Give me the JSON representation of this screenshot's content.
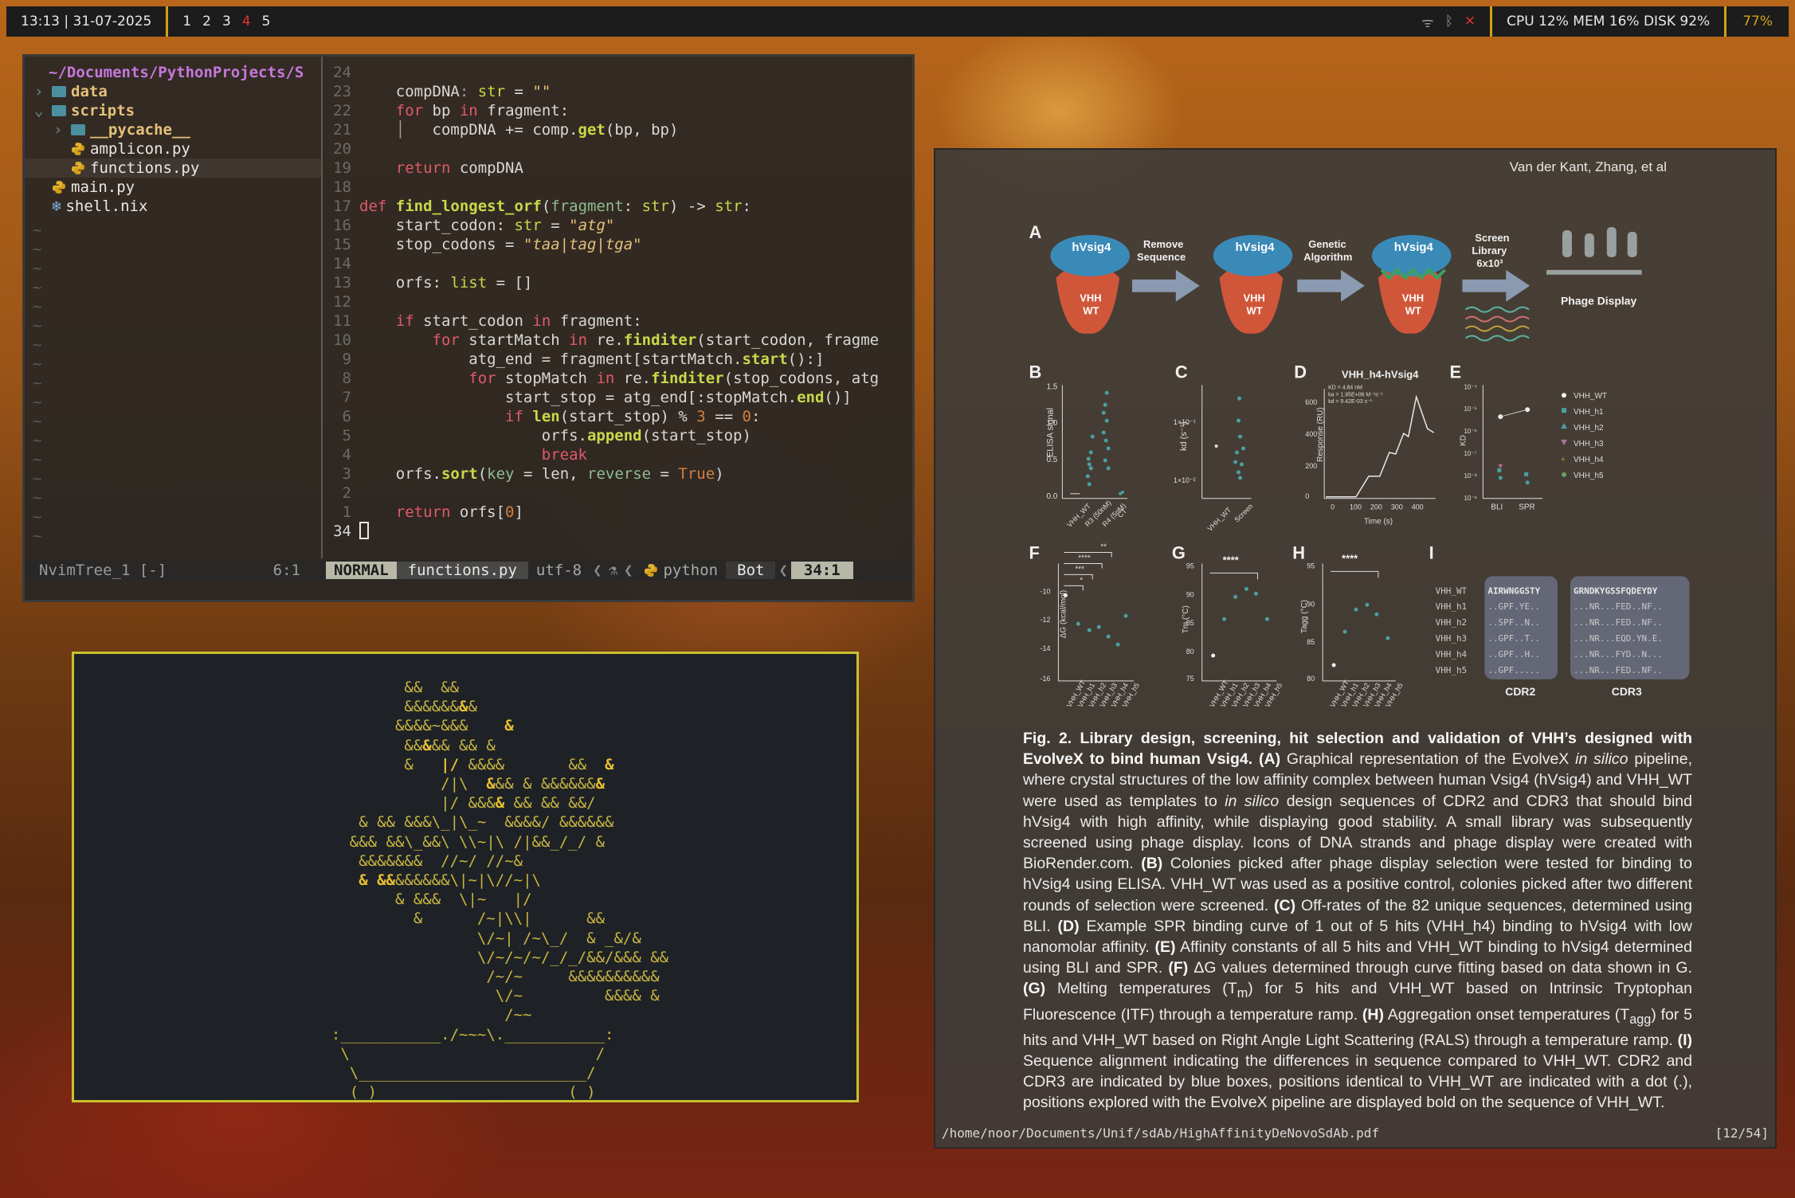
{
  "topbar": {
    "clock": "13:13 | 31-07-2025",
    "workspaces": [
      "1",
      "2",
      "3",
      "4",
      "5"
    ],
    "active_workspace": "4",
    "status_icons": [
      "wifi-icon",
      "bluetooth-icon",
      "close-icon"
    ],
    "resources": "CPU 12% MEM 16% DISK 92%",
    "battery": "77%"
  },
  "nvim": {
    "tree": {
      "root": "~/Documents/PythonProjects/S",
      "items": [
        {
          "chev": "›",
          "name": "data",
          "kind": "dir"
        },
        {
          "chev": "⌄",
          "name": "scripts",
          "kind": "dir"
        },
        {
          "chev": "›",
          "name": "__pycache__",
          "kind": "dir",
          "indent": 1
        },
        {
          "chev": "",
          "name": "amplicon.py",
          "kind": "py",
          "indent": 1
        },
        {
          "chev": "",
          "name": "functions.py",
          "kind": "py",
          "indent": 1,
          "selected": true
        },
        {
          "chev": "",
          "name": "main.py",
          "kind": "py"
        },
        {
          "chev": "",
          "name": "shell.nix",
          "kind": "nix"
        }
      ]
    },
    "status": {
      "tree_name": "NvimTree_1 [-]",
      "tree_pos": "6:1",
      "mode": "NORMAL",
      "file": "functions.py",
      "encoding": "utf-8",
      "filetype": "python",
      "scroll": "Bot",
      "position": "34:1"
    },
    "line_numbers": [
      "24",
      "23",
      "22",
      "21",
      "20",
      "19",
      "18",
      "17",
      "16",
      "15",
      "14",
      "13",
      "12",
      "11",
      "10",
      "9",
      "8",
      "7",
      "6",
      "5",
      "4",
      "3",
      "2",
      "1",
      "34"
    ]
  },
  "pdf": {
    "authors": "Van der Kant, Zhang, et al",
    "path": "/home/noor/Documents/Unif/sdAb/HighAffinityDeNovoSdAb.pdf",
    "page": "[12/54]",
    "figure": {
      "panelA": {
        "label": "A",
        "proteins": [
          "hVsig4",
          "hVsig4",
          "hVsig4"
        ],
        "binder": [
          "VHH",
          "WT"
        ],
        "steps": [
          "Remove",
          "Sequence",
          "Genetic",
          "Algorithm",
          "Screen",
          "Library",
          "6x10³"
        ],
        "phage": "Phage Display"
      },
      "panelB": {
        "label": "B",
        "ylabel": "ELISA signal",
        "yticks": [
          "1.5",
          "1.0",
          "0.5",
          "0.0"
        ],
        "xticks": [
          "VHH_WT",
          "R3 (50nM)",
          "R4 (5nM)",
          "CT"
        ]
      },
      "panelC": {
        "label": "C",
        "ylabel": "kd (s⁻¹)",
        "yticks": [
          "1×10⁻¹",
          "1×10⁻²"
        ],
        "xticks": [
          "VHH_WT",
          "Screen"
        ]
      },
      "panelD": {
        "label": "D",
        "title": "VHH_h4-hVsig4",
        "ylabel": "Response (RU)",
        "xlabel": "Time (s)",
        "yticks": [
          "600",
          "400",
          "200",
          "0"
        ],
        "xticks": [
          "0",
          "100",
          "200",
          "300",
          "400"
        ],
        "params": [
          "KD = 4.84 nM",
          "ka = 1.95E+06 M⁻¹s⁻¹",
          "kd = 9.42E-03 s⁻¹"
        ]
      },
      "panelE": {
        "label": "E",
        "ylabel": "KD",
        "yticks": [
          "10⁻⁴",
          "10⁻⁵",
          "10⁻⁶",
          "10⁻⁷",
          "10⁻⁸",
          "10⁻⁹"
        ],
        "xticks": [
          "BLI",
          "SPR"
        ],
        "legend": [
          "VHH_WT",
          "VHH_h1",
          "VHH_h2",
          "VHH_h3",
          "VHH_h4",
          "VHH_h5"
        ]
      },
      "panelF": {
        "label": "F",
        "ylabel": "ΔG (kcal/mol)",
        "yticks": [
          "-10",
          "-12",
          "-14",
          "-16"
        ],
        "sig": [
          "**",
          "****",
          "***",
          "*"
        ]
      },
      "panelG": {
        "label": "G",
        "ylabel": "Tm (°C)",
        "yticks": [
          "95",
          "90",
          "85",
          "80",
          "75"
        ],
        "sig": "****"
      },
      "panelH": {
        "label": "H",
        "ylabel": "Tagg (°C)",
        "yticks": [
          "95",
          "90",
          "85",
          "80"
        ],
        "sig": "****"
      },
      "xcats": [
        "VHH_WT",
        "VHH_h1",
        "VHH_h2",
        "VHH_h3",
        "VHH_h4",
        "VHH_h5"
      ],
      "panelI": {
        "label": "I",
        "rows": [
          "VHH_WT",
          "VHH_h1",
          "VHH_h2",
          "VHH_h3",
          "VHH_h4",
          "VHH_h5"
        ],
        "cdr2": [
          "AIRWNGGSTY",
          "..GPF.YE..",
          "..SPF..N..",
          "..GPF..T..",
          "..GPF..H..",
          "..GPF....."
        ],
        "cdr3": [
          "GRNDKYGSSFQDEYDY",
          "...NR...FED..NF..",
          "...NR...FED..NF..",
          "...NR...EQD.YN.E.",
          "...NR...FYD..N...",
          "...NR...FED..NF.."
        ],
        "labels": [
          "CDR2",
          "CDR3"
        ]
      }
    },
    "caption_html": "<b>Fig. 2. Library design, screening, hit selection and validation of VHH’s designed with EvolveX to bind human Vsig4.</b> <b>(A)</b> Graphical representation of the EvolveX <i>in silico</i> pipeline, where crystal structures of the low affinity complex between human Vsig4 (hVsig4) and VHH_WT were used as templates to <i>in silico</i> design sequences of CDR2 and CDR3 that should bind hVsig4 with high affinity, while displaying good stability. A small library was subsequently screened using phage display. Icons of DNA strands and phage display were created with BioRender.com. <b>(B)</b> Colonies picked after phage display selection were tested for binding to hVsig4 using ELISA. VHH_WT was used as a positive control, colonies picked after two different rounds of selection were screened. <b>(C)</b> Off-rates of the 82 unique sequences, determined using BLI. <b>(D)</b> Example SPR binding curve of 1 out of 5 hits (VHH_h4) binding to hVsig4 with low nanomolar affinity. <b>(E)</b> Affinity constants of all 5 hits and VHH_WT binding to hVsig4 determined using BLI and SPR. <b>(F)</b> ΔG values determined through curve fitting based on data shown in G. <b>(G)</b> Melting temperatures (T<sub>m</sub>) for 5 hits and VHH_WT based on Intrinsic Tryptophan Fluorescence (ITF) through a temperature ramp. <b>(H)</b> Aggregation onset temperatures (T<sub>agg</sub>) for 5 hits and VHH_WT based on Right Angle Light Scattering (RALS) through a temperature ramp. <b>(I)</b> Sequence alignment indicating the differences in sequence compared to VHH_WT. CDR2 and CDR3 are indicated by blue boxes, positions identical to VHH_WT are indicated with a dot (.), positions explored with the EvolveX pipeline are displayed bold on the sequence of VHH_WT."
  }
}
